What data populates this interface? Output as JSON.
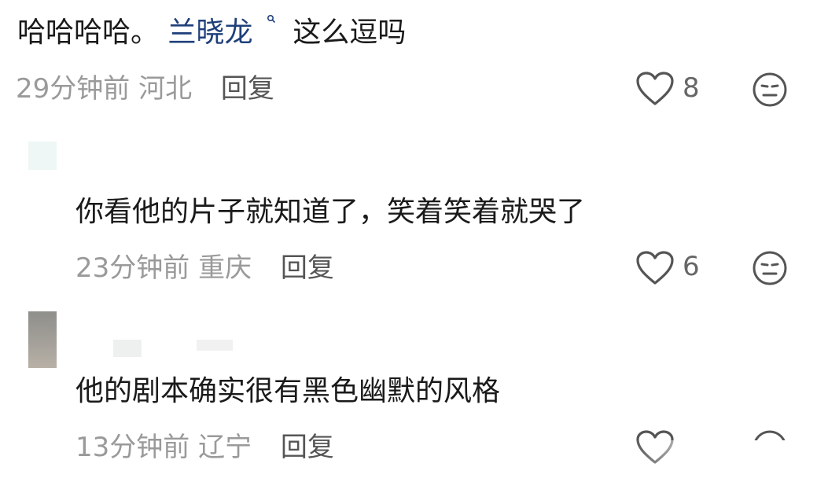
{
  "comments": [
    {
      "text_prefix": "哈哈哈哈。",
      "mention": "兰晓龙",
      "text_suffix": "这么逗吗",
      "time": "29分钟前",
      "location": "河北",
      "reply_label": "回复",
      "likes": "8"
    },
    {
      "text": "你看他的片子就知道了，笑着笑着就哭了",
      "time": "23分钟前",
      "location": "重庆",
      "reply_label": "回复",
      "likes": "6"
    },
    {
      "text": "他的剧本确实很有黑色幽默的风格",
      "time": "13分钟前",
      "location": "辽宁",
      "reply_label": "回复",
      "likes": ""
    }
  ],
  "icons": {
    "like": "heart-outline-icon",
    "react": "neutral-face-icon"
  },
  "colors": {
    "mention": "#1f3f7a",
    "meta": "#9a9a9a",
    "icon": "#555555"
  }
}
